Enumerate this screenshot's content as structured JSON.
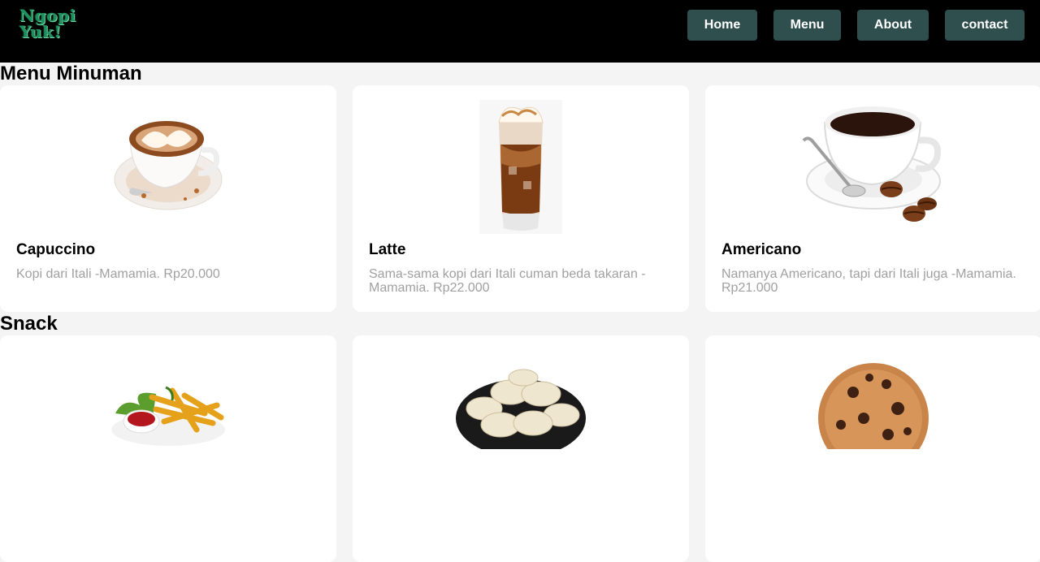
{
  "brand": {
    "line1": "Ngopi",
    "line2": "Yuk!"
  },
  "nav": {
    "home": "Home",
    "menu": "Menu",
    "about": "About",
    "contact": "contact"
  },
  "sections": {
    "drinks_title": "Menu Minuman",
    "snack_title": "Snack"
  },
  "drinks": [
    {
      "name": "Capuccino",
      "desc": "Kopi dari Itali -Mamamia. Rp20.000",
      "icon": "cappuccino-cup-image"
    },
    {
      "name": "Latte",
      "desc": "Sama-sama kopi dari Itali cuman beda takaran -Mamamia. Rp22.000",
      "icon": "iced-latte-glass-image"
    },
    {
      "name": "Americano",
      "desc": "Namanya Americano, tapi dari Itali juga -Mamamia. Rp21.000",
      "icon": "americano-cup-image"
    }
  ],
  "snacks": [
    {
      "icon": "french-fries-image"
    },
    {
      "icon": "dumplings-image"
    },
    {
      "icon": "cookie-image"
    }
  ],
  "colors": {
    "navbar": "#000000",
    "nav_button": "#2f4f4f",
    "logo": "#1e8f5e",
    "page_bg": "#f4f4f4",
    "desc_text": "#a0a0a0"
  }
}
